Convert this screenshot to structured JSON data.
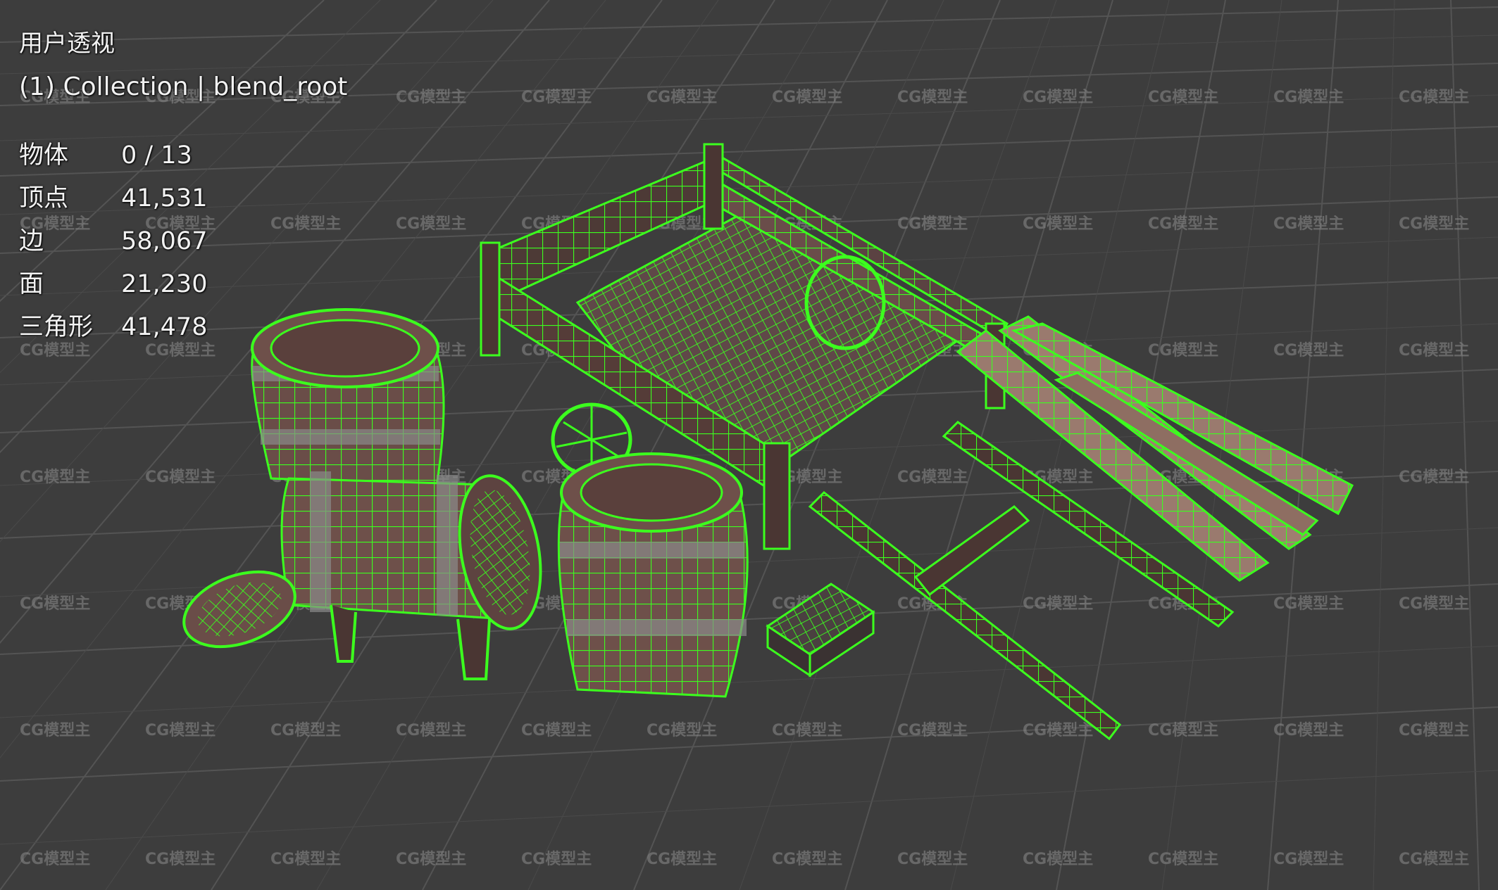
{
  "viewport": {
    "view_name": "用户透视",
    "collection_info": "(1) Collection | blend_root",
    "stats": [
      {
        "label": "物体",
        "value": "0 / 13"
      },
      {
        "label": "顶点",
        "value": "41,531"
      },
      {
        "label": "边",
        "value": "58,067"
      },
      {
        "label": "面",
        "value": "21,230"
      },
      {
        "label": "三角形",
        "value": "41,478"
      }
    ]
  },
  "colors": {
    "background": "#3d3d3d",
    "grid": "#555555",
    "wireframe": "#3cff1e",
    "wood": "#6a4a44",
    "metal": "#8a8a8a",
    "watermark": "#8a8a8a"
  },
  "watermark": "CG模型主"
}
